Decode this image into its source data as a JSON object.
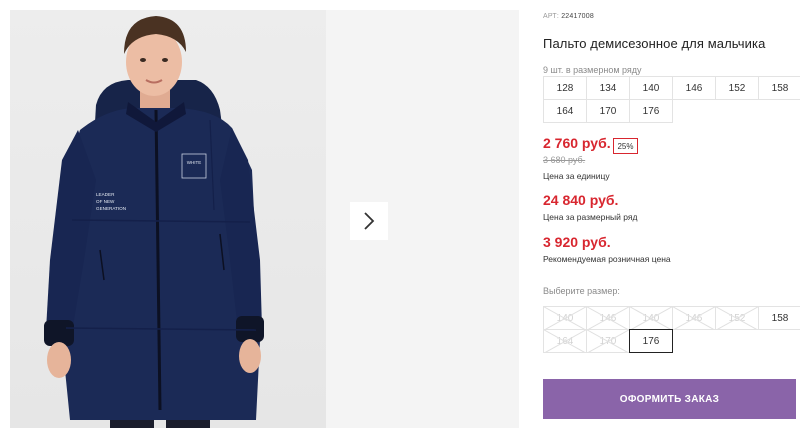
{
  "product": {
    "article_label": "АРТ:",
    "article_code": "22417008",
    "title": "Пальто демисезонное для мальчика",
    "pack_note": "9 шт. в размерном ряду",
    "pack_sizes": [
      "128",
      "134",
      "140",
      "146",
      "152",
      "158",
      "164",
      "170",
      "176"
    ],
    "jacket_print": {
      "chest_logo": "WHITE",
      "sleeve_text": [
        "LEADER",
        "OF NEW",
        "GENERATION"
      ]
    }
  },
  "pricing": {
    "unit_price": "2 760 руб.",
    "discount": "25%",
    "old_price": "3 680 руб.",
    "unit_label": "Цена за единицу",
    "pack_price": "24 840 руб.",
    "pack_label": "Цена за размерный ряд",
    "retail_price": "3 920 руб.",
    "retail_label": "Рекомендуемая розничная цена"
  },
  "size_selector": {
    "label": "Выберите размер:",
    "options": [
      {
        "size": "140",
        "state": "unavailable"
      },
      {
        "size": "146",
        "state": "unavailable"
      },
      {
        "size": "140",
        "state": "unavailable"
      },
      {
        "size": "146",
        "state": "unavailable"
      },
      {
        "size": "152",
        "state": "unavailable"
      },
      {
        "size": "158",
        "state": "available"
      },
      {
        "size": "164",
        "state": "unavailable"
      },
      {
        "size": "170",
        "state": "unavailable"
      },
      {
        "size": "176",
        "state": "selected"
      }
    ]
  },
  "actions": {
    "order_label": "ОФОРМИТЬ ЗАКАЗ",
    "next_image_icon": "chevron-right-icon"
  },
  "colors": {
    "accent_price": "#d8262f",
    "order_button": "#8a64a9",
    "jacket": "#1b2a56"
  }
}
